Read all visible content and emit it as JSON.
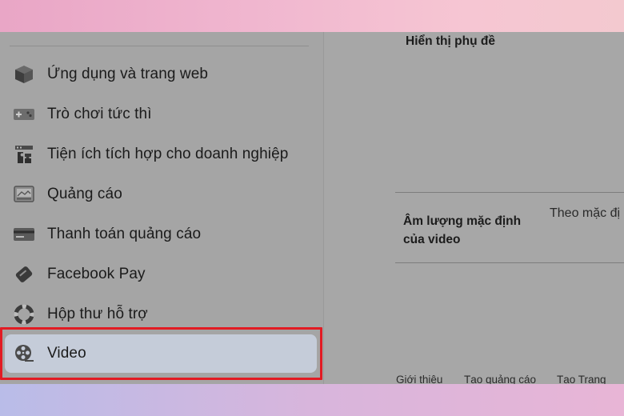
{
  "sidebar": {
    "items": [
      {
        "label": "Ứng dụng và trang web",
        "icon": "cube-icon"
      },
      {
        "label": "Trò chơi tức thì",
        "icon": "gamepad-icon"
      },
      {
        "label": "Tiện ích tích hợp cho doanh nghiệp",
        "icon": "puzzle-icon"
      },
      {
        "label": "Quảng cáo",
        "icon": "ad-icon"
      },
      {
        "label": "Thanh toán quảng cáo",
        "icon": "credit-card-icon"
      },
      {
        "label": "Facebook Pay",
        "icon": "pay-tag-icon"
      },
      {
        "label": "Hộp thư hỗ trợ",
        "icon": "lifebuoy-icon"
      },
      {
        "label": "Video",
        "icon": "film-reel-icon",
        "selected": true
      }
    ]
  },
  "settings": {
    "captions_label": "Hiển thị phụ đề",
    "volume_label_line1": "Âm lượng mặc định",
    "volume_label_line2": "của video",
    "volume_value": "Theo mặc đị"
  },
  "footer": {
    "links": [
      "Giới thiệu",
      "Tạo quảng cáo",
      "Tạo Trang"
    ]
  },
  "colors": {
    "highlight": "#e21b23",
    "selected_bg": "#c5ccd9"
  }
}
